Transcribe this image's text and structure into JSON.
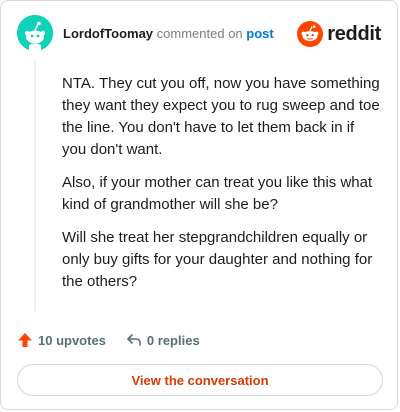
{
  "header": {
    "username": "LordofToomay",
    "action_text": "commented on",
    "post_link": "post",
    "logo_text": "reddit"
  },
  "comment": {
    "paragraphs": [
      "NTA. They cut you off, now you have something they want they expect you to rug sweep and toe the line. You don't have to let them back in if you don't want.",
      "Also, if your mother can treat you like this what kind of grandmother will she be?",
      "Will she treat her stepgrandchildren equally or only buy gifts for your daughter and nothing for the others?"
    ]
  },
  "actions": {
    "upvotes": "10 upvotes",
    "replies": "0 replies"
  },
  "cta": {
    "label": "View the conversation"
  },
  "colors": {
    "accent": "#ff4500",
    "link": "#0079d3",
    "button_text": "#d93a00",
    "avatar": "#0dd3bb"
  },
  "icons": [
    "snoo-avatar-icon",
    "reddit-logo-icon",
    "upvote-arrow-icon",
    "reply-arrow-icon"
  ]
}
